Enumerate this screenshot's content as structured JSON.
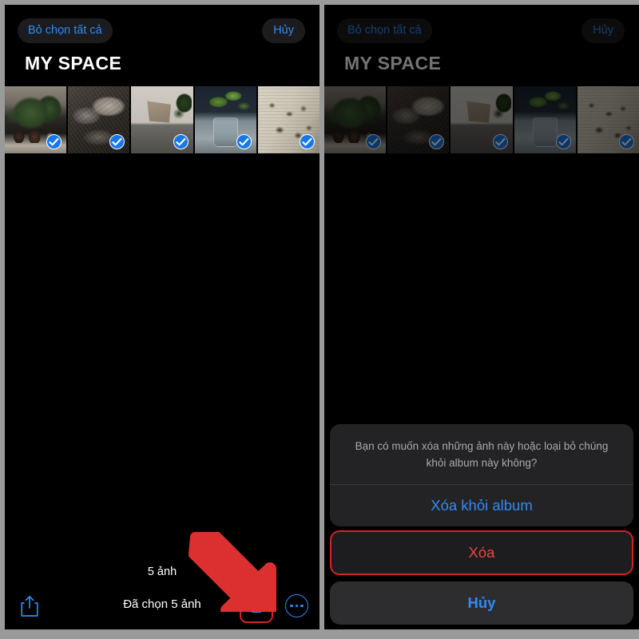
{
  "colors": {
    "accent_blue": "#2f8bf7",
    "destructive_red": "#e8453c",
    "annotation_red": "#d62222",
    "check_blue": "#1878e8",
    "panel_background": "#000000",
    "sheet_background": "#232325",
    "frame_gray": "#9a9a9a"
  },
  "left_panel": {
    "header": {
      "deselect_all_label": "Bỏ chọn tất cả",
      "cancel_label": "Hủy",
      "album_title": "MY SPACE"
    },
    "thumbnails": [
      {
        "name": "potted-plants-on-ledge",
        "art_class": "art-plants",
        "selected": true
      },
      {
        "name": "bed-with-cushions",
        "art_class": "art-bed",
        "selected": true
      },
      {
        "name": "folding-canvas-chair",
        "art_class": "art-chair",
        "selected": true
      },
      {
        "name": "plant-cutting-in-glass",
        "art_class": "art-glass",
        "selected": true
      },
      {
        "name": "newspaper-butterfly-collage",
        "art_class": "art-paper",
        "selected": true
      }
    ],
    "photo_count_label": "5 ảnh",
    "toolbar": {
      "share_icon": "share-icon",
      "selected_label": "Đã chọn 5 ảnh",
      "trash_icon": "trash-icon",
      "more_icon": "more-options-icon"
    },
    "annotation": {
      "arrow_icon": "red-arrow-pointing-down-right",
      "highlight_target": "trash-icon"
    }
  },
  "right_panel": {
    "header": {
      "deselect_all_label": "Bỏ chọn tất cả",
      "cancel_label": "Hủy",
      "album_title": "MY SPACE"
    },
    "thumbnails": [
      {
        "name": "potted-plants-on-ledge",
        "art_class": "art-plants",
        "selected": true
      },
      {
        "name": "bed-with-cushions",
        "art_class": "art-bed",
        "selected": true
      },
      {
        "name": "folding-canvas-chair",
        "art_class": "art-chair",
        "selected": true
      },
      {
        "name": "plant-cutting-in-glass",
        "art_class": "art-glass",
        "selected": true
      },
      {
        "name": "newspaper-butterfly-collage",
        "art_class": "art-paper",
        "selected": true
      }
    ],
    "action_sheet": {
      "message": "Bạn có muốn xóa những ảnh này hoặc loại bỏ chúng khỏi album này không?",
      "remove_from_album_label": "Xóa khỏi album",
      "delete_label": "Xóa",
      "cancel_label": "Hủy",
      "highlighted_action": "Xóa"
    }
  }
}
